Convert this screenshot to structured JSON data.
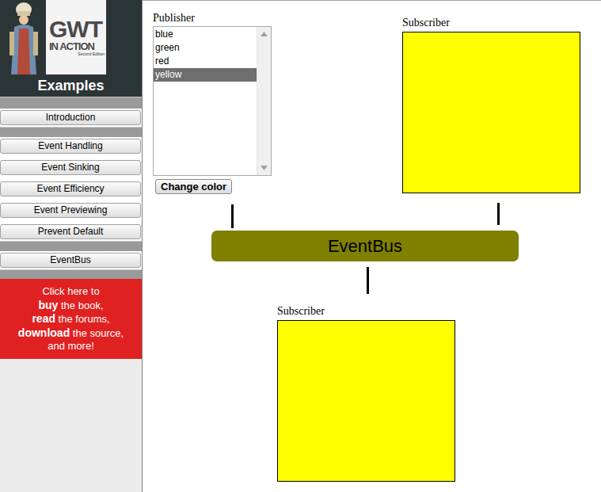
{
  "logo": {
    "title": "GWT",
    "subtitle": "IN ACTION",
    "edition": "Second Edition"
  },
  "sidebar": {
    "header": "Examples",
    "groups": [
      [
        {
          "label": "Introduction",
          "selected": false
        }
      ],
      [
        {
          "label": "Event Handling",
          "selected": false
        },
        {
          "label": "Event Sinking",
          "selected": false
        },
        {
          "label": "Event Efficiency",
          "selected": false
        },
        {
          "label": "Event Previewing",
          "selected": false
        },
        {
          "label": "Prevent Default",
          "selected": false
        }
      ],
      [
        {
          "label": "EventBus",
          "selected": false
        }
      ]
    ],
    "promo": [
      [
        {
          "text": "Click here to",
          "bold": false
        }
      ],
      [
        {
          "text": "buy",
          "bold": true
        },
        {
          "text": " the book,",
          "bold": false
        }
      ],
      [
        {
          "text": "read",
          "bold": true
        },
        {
          "text": " the forums,",
          "bold": false
        }
      ],
      [
        {
          "text": "download",
          "bold": true
        },
        {
          "text": " the source,",
          "bold": false
        }
      ],
      [
        {
          "text": "and more!",
          "bold": false
        }
      ]
    ]
  },
  "publisher": {
    "label": "Publisher",
    "options": [
      {
        "label": "blue",
        "selected": false
      },
      {
        "label": "green",
        "selected": false
      },
      {
        "label": "red",
        "selected": false
      },
      {
        "label": "yellow",
        "selected": true
      }
    ],
    "button": "Change color"
  },
  "event_bus": {
    "label": "EventBus"
  },
  "subscribers": [
    {
      "label": "Subscriber",
      "color": "#ffff00"
    },
    {
      "label": "Subscriber",
      "color": "#ffff00"
    }
  ]
}
